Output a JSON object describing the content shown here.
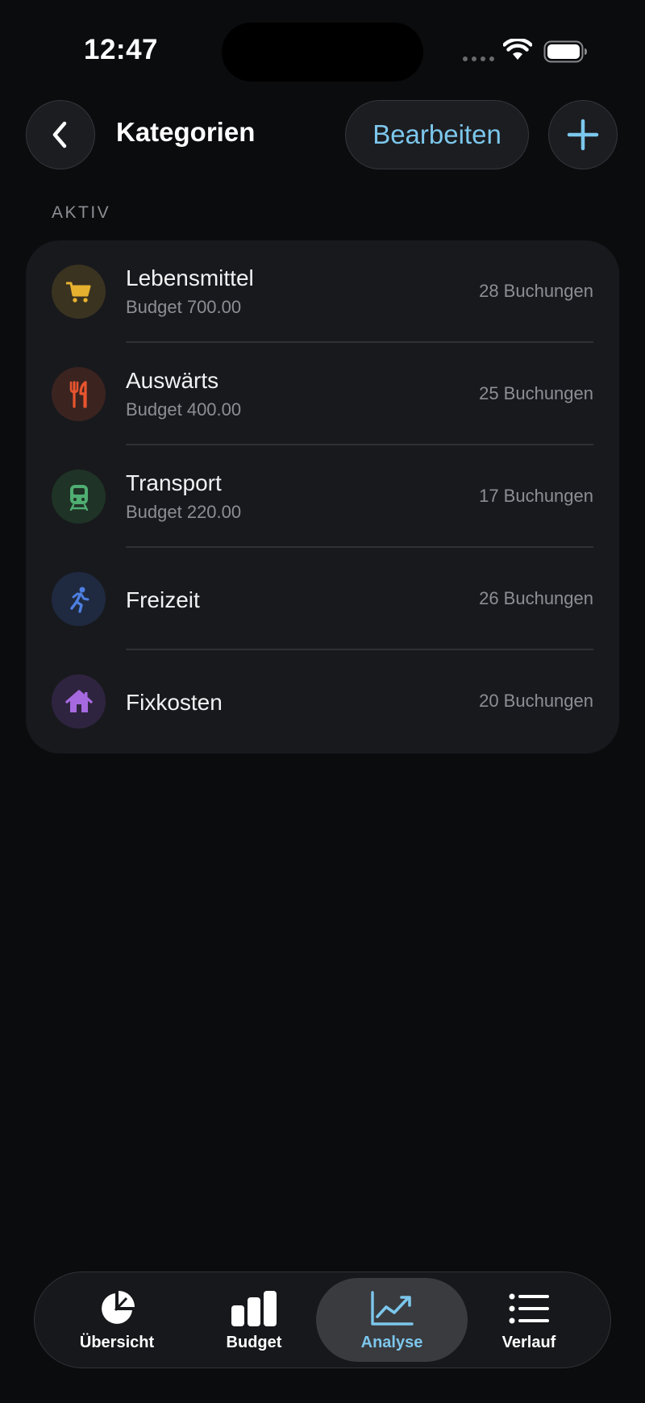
{
  "status": {
    "time": "12:47"
  },
  "nav": {
    "title": "Kategorien",
    "edit_label": "Bearbeiten",
    "accent": "#7cc7ec"
  },
  "section": {
    "title": "AKTIV"
  },
  "categories": [
    {
      "name": "Lebensmittel",
      "budget": "Budget 700.00",
      "count": "28 Buchungen",
      "icon": "cart-icon",
      "color": "#e6b12e",
      "bg": "#3a3320"
    },
    {
      "name": "Auswärts",
      "budget": "Budget 400.00",
      "count": "25 Buchungen",
      "icon": "fork-knife-icon",
      "color": "#e8552f",
      "bg": "#3b2420"
    },
    {
      "name": "Transport",
      "budget": "Budget 220.00",
      "count": "17 Buchungen",
      "icon": "tram-icon",
      "color": "#4fae72",
      "bg": "#1f3326"
    },
    {
      "name": "Freizeit",
      "budget": "",
      "count": "26 Buchungen",
      "icon": "running-figure-icon",
      "color": "#4d7fe0",
      "bg": "#1f2a40"
    },
    {
      "name": "Fixkosten",
      "budget": "",
      "count": "20 Buchungen",
      "icon": "house-icon",
      "color": "#a669e0",
      "bg": "#2f2440"
    }
  ],
  "tabs": [
    {
      "label": "Übersicht",
      "icon": "pie-chart-icon",
      "active": false
    },
    {
      "label": "Budget",
      "icon": "bar-chart-icon",
      "active": false
    },
    {
      "label": "Analyse",
      "icon": "line-chart-icon",
      "active": true
    },
    {
      "label": "Verlauf",
      "icon": "list-icon",
      "active": false
    }
  ]
}
